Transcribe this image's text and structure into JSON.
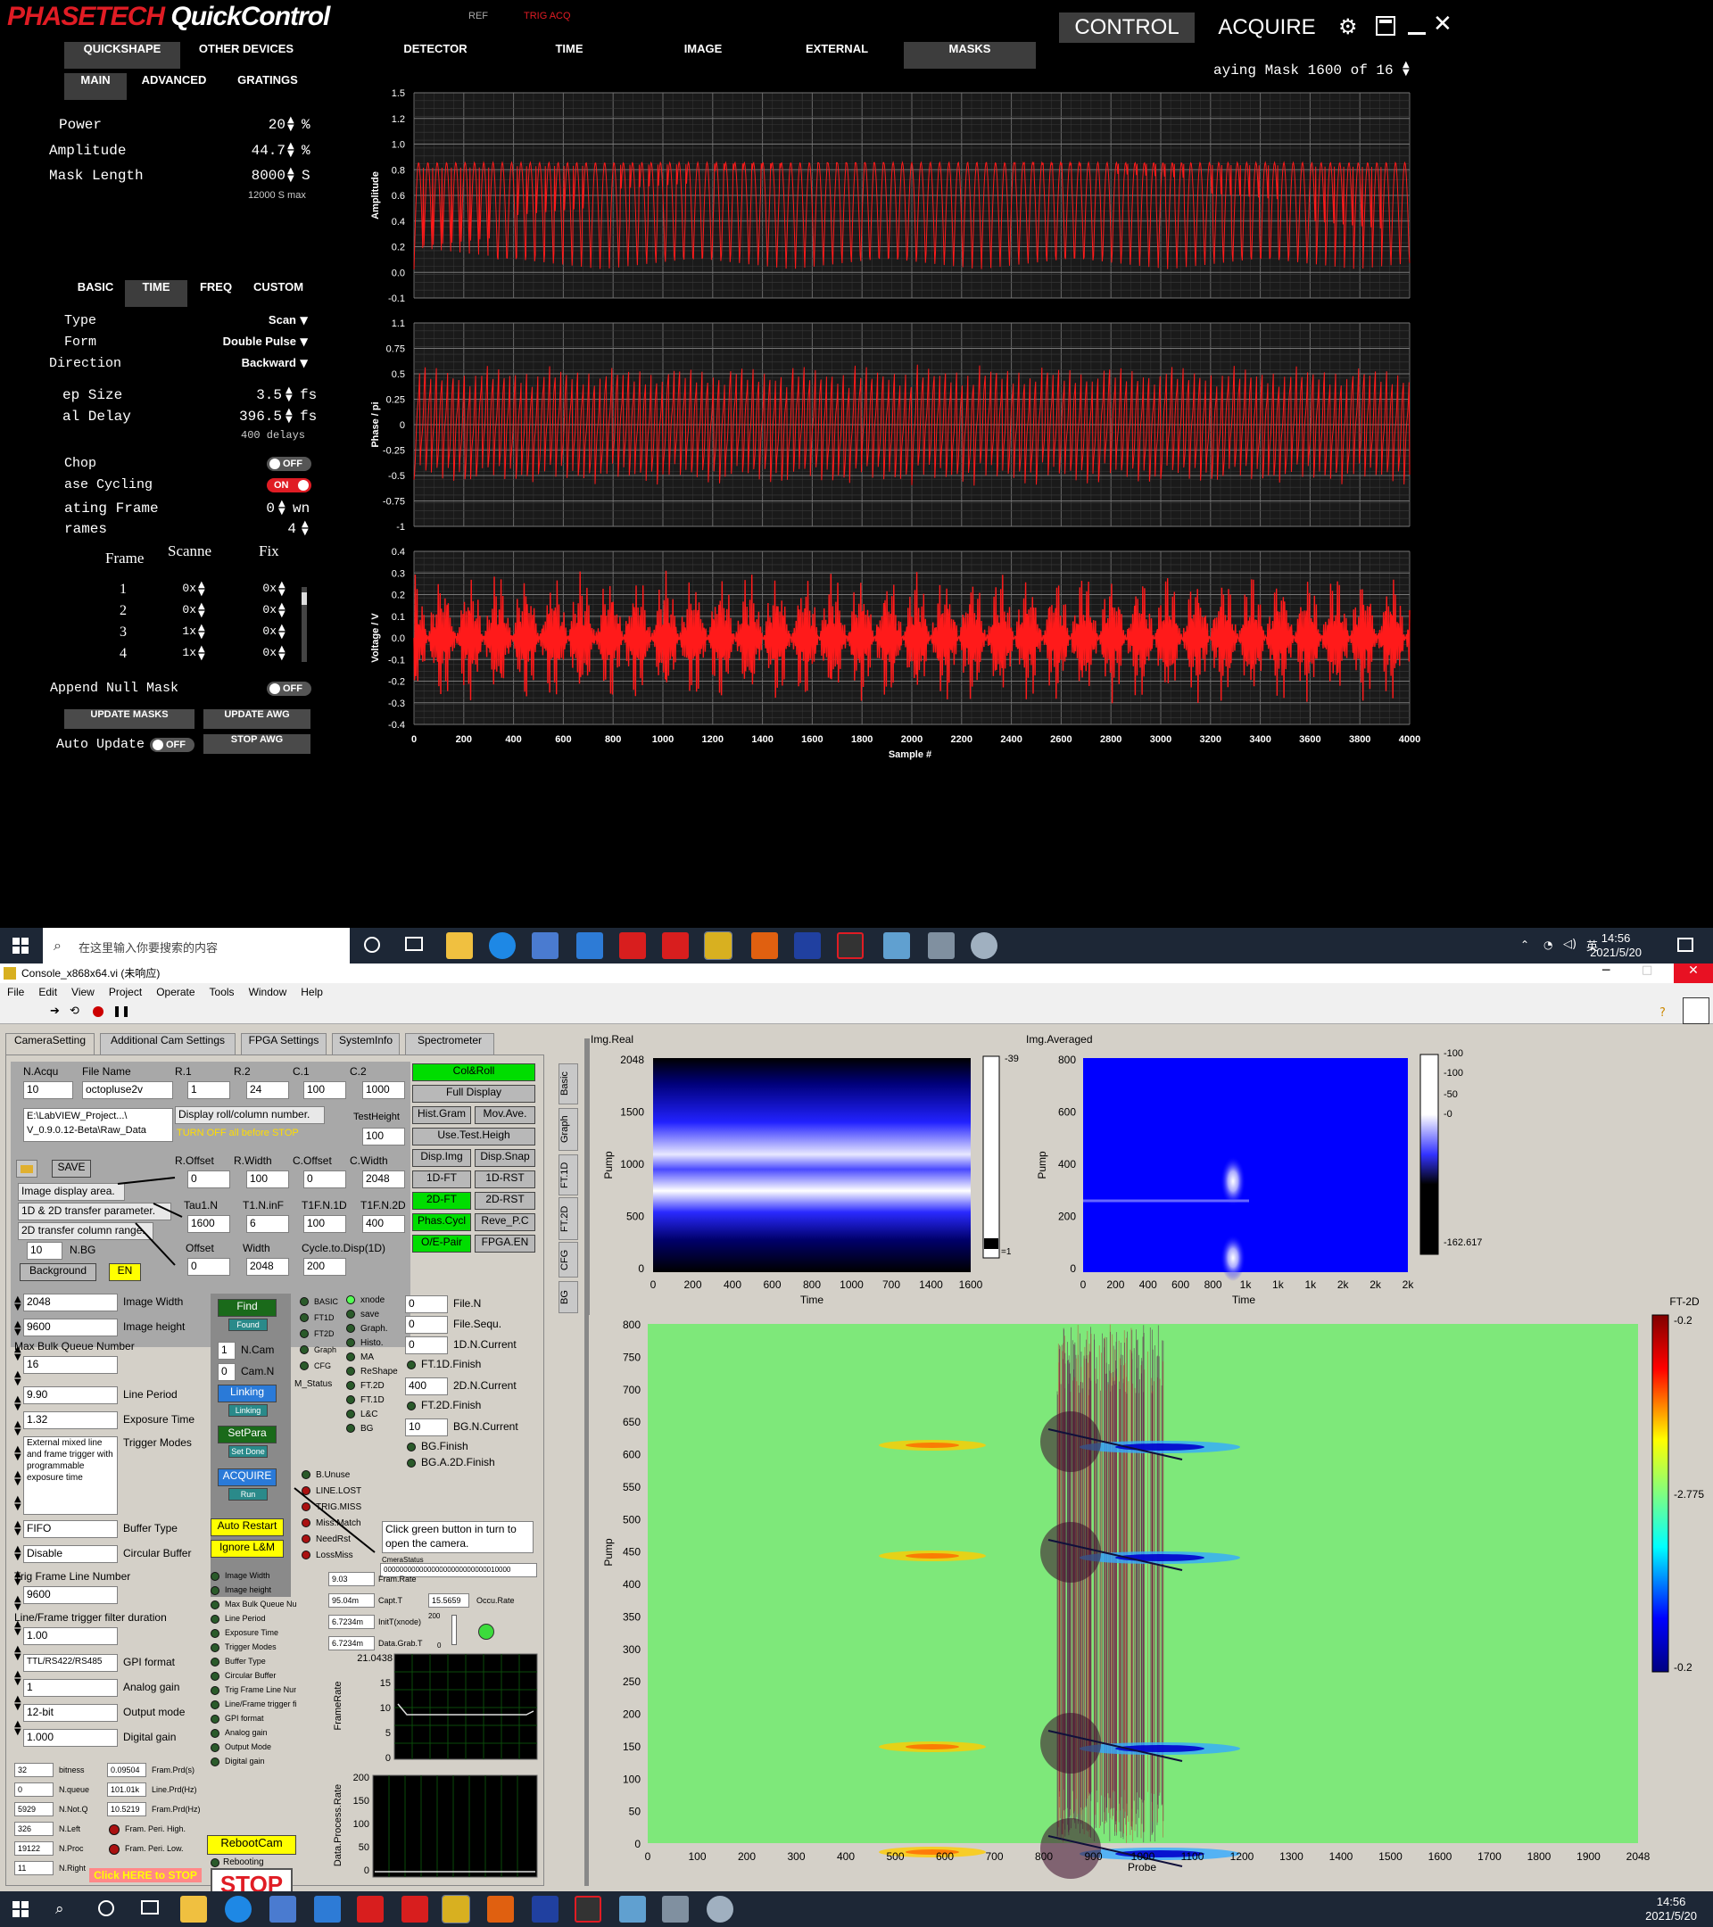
{
  "app": {
    "logo_part1": "PHASETECH",
    "logo_part2": "QuickControl",
    "ref_label": "REF",
    "trig_label": "TRIG ACQ",
    "control_label": "CONTROL",
    "acquire_label": "ACQUIRE",
    "brand_red": "#e01c24"
  },
  "tabs_left": [
    "QUICKSHAPE",
    "OTHER DEVICES"
  ],
  "subtabs_left": [
    "MAIN",
    "ADVANCED",
    "GRATINGS"
  ],
  "tabs_right": [
    "DETECTOR",
    "TIME",
    "IMAGE",
    "EXTERNAL",
    "MASKS"
  ],
  "mask_status": "aying Mask 1600 of 16",
  "main": {
    "power_label": "Power",
    "power_value": "20",
    "power_unit": "%",
    "amplitude_label": "Amplitude",
    "amplitude_value": "44.7",
    "amplitude_unit": "%",
    "mask_length_label": "Mask Length",
    "mask_length_value": "8000",
    "mask_length_unit": "S",
    "mask_max": "12000 S max"
  },
  "subtabs2": [
    "BASIC",
    "TIME",
    "FREQ",
    "CUSTOM"
  ],
  "time": {
    "type_label": "Type",
    "type_value": "Scan",
    "form_label": "Form",
    "form_value": "Double Pulse",
    "direction_label": "Direction",
    "direction_value": "Backward",
    "step_label": "ep Size",
    "step_value": "3.5",
    "step_unit": "fs",
    "delay_label": "al Delay",
    "delay_value": "396.5",
    "delay_unit": "fs",
    "delays_note": "400 delays",
    "chop_label": "Chop",
    "chop_state": "OFF",
    "phase_label": "ase Cycling",
    "phase_state": "ON",
    "rotating_label": "ating  Frame",
    "rotating_value": "0",
    "rotating_unit": "wn",
    "frames_label": "rames",
    "frames_value": "4",
    "frame_col": "Frame",
    "scanned_col": "Scanne",
    "fixed_col": "Fix",
    "rows": [
      {
        "n": "1",
        "s": "0x",
        "f": "0x"
      },
      {
        "n": "2",
        "s": "0x",
        "f": "0x"
      },
      {
        "n": "3",
        "s": "1x",
        "f": "0x"
      },
      {
        "n": "4",
        "s": "1x",
        "f": "0x"
      }
    ],
    "append_label": "Append Null Mask",
    "append_state": "OFF",
    "update_masks": "UPDATE MASKS",
    "update_awg": "UPDATE AWG",
    "auto_update_label": "Auto Update",
    "auto_update_state": "OFF",
    "stop_awg": "STOP AWG"
  },
  "plots": {
    "amp_ylabel": "Amplitude",
    "amp_yticks": [
      "1.5",
      "1.2",
      "1.0",
      "0.8",
      "0.6",
      "0.4",
      "0.2",
      "0.0",
      "-0.1"
    ],
    "phase_ylabel": "Phase / pi",
    "phase_yticks": [
      "1.1",
      "0.75",
      "0.5",
      "0.25",
      "0",
      "-0.25",
      "-0.5",
      "-0.75",
      "-1"
    ],
    "volt_ylabel": "Voltage / V",
    "volt_yticks": [
      "0.4",
      "0.3",
      "0.2",
      "0.1",
      "0.0",
      "-0.1",
      "-0.2",
      "-0.3",
      "-0.4"
    ],
    "xticks": [
      "0",
      "200",
      "400",
      "600",
      "800",
      "1000",
      "1200",
      "1400",
      "1600",
      "1800",
      "2000",
      "2200",
      "2400",
      "2600",
      "2800",
      "3000",
      "3200",
      "3400",
      "3600",
      "3800",
      "4000"
    ],
    "xlabel": "Sample #",
    "trace_color": "#ff1a1a"
  },
  "taskbar": {
    "search_placeholder": "在这里输入你要搜索的内容",
    "time": "14:56",
    "date": "2021/5/20",
    "lang": "英"
  },
  "lv": {
    "title": "Console_x868x64.vi (未响应)",
    "menu": [
      "File",
      "Edit",
      "View",
      "Project",
      "Operate",
      "Tools",
      "Window",
      "Help"
    ],
    "tabs": [
      "CameraSetting",
      "Additional Cam Settings",
      "FPGA Settings",
      "SystemInfo",
      "Spectrometer"
    ],
    "vtabs": [
      "Basic",
      "Graph",
      "FT.1D",
      "FT.2D",
      "CFG",
      "BG"
    ],
    "nacqu_label": "N.Acqu",
    "nacqu_value": "10",
    "filename_label": "File Name",
    "filename_value": "octopluse2v",
    "path_value": "E:\\LabVIEW_Project...\\ V_0.9.0.12-Beta\\Raw_Data",
    "r1_label": "R.1",
    "r1": "1",
    "r2_label": "R.2",
    "r2": "24",
    "c1_label": "C.1",
    "c1": "100",
    "c2_label": "C.2",
    "c2": "1000",
    "display_note": "Display roll/column number.",
    "turn_off_note": "TURN OFF all before STOP",
    "testheight_label": "TestHeight",
    "testheight": "100",
    "save_label": "SAVE",
    "roffset_label": "R.Offset",
    "roffset": "0",
    "rwidth_label": "R.Width",
    "rwidth": "100",
    "coffset_label": "C.Offset",
    "coffset": "0",
    "cwidth_label": "C.Width",
    "cwidth": "2048",
    "image_area_note": "Image display area.",
    "transfer_note": "1D & 2D transfer parameter.",
    "col_range_note": "2D transfer column range.",
    "tau1_label": "Tau1.N",
    "tau1": "1600",
    "t1finf_label": "T1.N.inF",
    "t1finf": "6",
    "t1fn1d_label": "T1F.N.1D",
    "t1fn1d": "100",
    "t1fn2d_label": "T1F.N.2D",
    "t1fn2d": "400",
    "offset_label": "Offset",
    "offset": "0",
    "width_label": "Width",
    "width": "2048",
    "cycle_label": "Cycle.to.Disp(1D)",
    "cycle": "200",
    "nbg_label": "N.BG",
    "nbg": "10",
    "background_label": "Background",
    "en_label": "EN",
    "right_btns": [
      [
        "Col&Roll",
        ""
      ],
      [
        "Full Display",
        ""
      ],
      [
        "Hist.Gram",
        "Mov.Ave."
      ],
      [
        "Use.Test.Heigh",
        ""
      ],
      [
        "Disp.Img",
        "Disp.Snap"
      ],
      [
        "1D-FT",
        "1D-RST"
      ],
      [
        "2D-FT",
        "2D-RST"
      ],
      [
        "Phas.Cycl",
        "Reve_P.C"
      ],
      [
        "O/E-Pair",
        "FPGA.EN"
      ]
    ],
    "image_width_label": "Image Width",
    "image_width": "2048",
    "image_height_label": "Image height",
    "image_height": "9600",
    "max_bulk_label": "Max Bulk Queue Number",
    "max_bulk": "16",
    "line_period_label": "Line Period",
    "line_period": "9.90",
    "exposure_label": "Exposure Time",
    "exposure": "1.32",
    "trigger_modes_label": "Trigger Modes",
    "trigger_modes_value": "External mixed line and frame trigger with programmable exposure time",
    "buffer_type_label": "Buffer Type",
    "buffer_type": "FIFO",
    "circular_label": "Circular Buffer",
    "circular": "Disable",
    "trig_frame_label": "Trig Frame Line Number",
    "trig_frame": "9600",
    "filter_label": "Line/Frame trigger filter duration",
    "filter": "1.00",
    "gpi_label": "GPI format",
    "gpi": "TTL/RS422/RS485",
    "analog_label": "Analog gain",
    "analog": "1",
    "output_label": "Output mode",
    "output": "12-bit",
    "digital_label": "Digital gain",
    "digital": "1.000",
    "find": "Find",
    "found": "Found",
    "ncam_label": "N.Cam",
    "ncam": "1",
    "camn_label": "Cam.N",
    "camn": "0",
    "linking": "Linking",
    "linking2": "Linking",
    "setpara": "SetPara",
    "setdone": "Set Done",
    "acquire": "ACQUIRE",
    "run": "Run",
    "status_leds": [
      "BASIC",
      "FT1D",
      "FT2D",
      "Graph",
      "CFG"
    ],
    "mstatus_label": "M_Status",
    "right_leds": [
      "xnode",
      "save",
      "Graph.",
      "Histo.",
      "MA",
      "ReShape",
      "FT.2D",
      "FT.1D",
      "L&C",
      "BG"
    ],
    "filen_label": "File.N",
    "filen": "0",
    "filesequ_label": "File.Sequ.",
    "filesequ": "0",
    "n1d_label": "1D.N.Current",
    "n1d": "0",
    "ft1d_finish": "FT.1D.Finish",
    "n2d_label": "2D.N.Current",
    "n2d": "400",
    "ft2d_finish": "FT.2D.Finish",
    "bgn_label": "BG.N.Current",
    "bgn": "10",
    "bg_finish": "BG.Finish",
    "bga_finish": "BG.A.2D.Finish",
    "err_leds": [
      "B.Unuse",
      "LINE.LOST",
      "TRIG.MISS",
      "Miss.Match",
      "NeedRst",
      "LossMiss"
    ],
    "click_note": "Click green button in turn to open the camera.",
    "camstatus_label": "CmeraStatus",
    "camstatus": "00000000000000000000000000010000",
    "auto_restart": "Auto Restart",
    "ignore_lm": "Ignore L&M",
    "param_leds": [
      "Image Width",
      "Image height",
      "Max Bulk Queue Number",
      "Line Period",
      "Exposure Time",
      "Trigger Modes",
      "Buffer Type",
      "Circular Buffer",
      "Trig Frame Line Number",
      "Line/Frame trigger filter duration",
      "GPI format",
      "Analog gain",
      "Output Mode",
      "Digital gain"
    ],
    "framrate_label": "Fram.Rate",
    "framrate": "9.03",
    "captt_label": "Capt.T",
    "captt": "95.04m",
    "occurate_label": "Occu.Rate",
    "occurate": "15.5659",
    "initt_label": "InitT(xnode)",
    "initt": "6.7234m",
    "datagrab_label": "Data.Grab.T",
    "datagrab": "6.7234m",
    "slider_top": "200",
    "slider_bot": "0",
    "framerate_chart_label": "FrameRate",
    "framerate_max": "21.0438",
    "fr_ticks": [
      "15",
      "10",
      "5",
      "0"
    ],
    "dp_chart_label": "Data.Process.Rate",
    "dp_ticks": [
      "200",
      "150",
      "100",
      "50",
      "0"
    ],
    "stats": [
      [
        "32",
        "bitness",
        "0.09504",
        "Fram.Prd(s)"
      ],
      [
        "0",
        "N.queue",
        "101.01k",
        "Line.Prd(Hz)"
      ],
      [
        "5929",
        "N.Not.Q",
        "10.5219",
        "Fram.Prd(Hz)"
      ],
      [
        "326",
        "N.Left",
        "",
        "Fram. Peri. High."
      ],
      [
        "19122",
        "N.Proc",
        "",
        "Fram. Peri. Low."
      ],
      [
        "11",
        "N.Right",
        "",
        ""
      ]
    ],
    "click_stop": "Click HERE to STOP",
    "rebootcam": "RebootCam",
    "rebooting": "Rebooting",
    "stop": "STOP",
    "img_real_label": "Img.Real",
    "img_real_yticks": [
      "2048",
      "1500",
      "1000",
      "500",
      "0"
    ],
    "img_real_xticks": [
      "0",
      "200",
      "400",
      "600",
      "800",
      "1000",
      "700",
      "1400",
      "1600"
    ],
    "img_real_ylabel": "Pump",
    "img_real_xlabel": "Time",
    "img_real_scale": [
      "-39",
      "=1"
    ],
    "img_avg_label": "Img.Averaged",
    "img_avg_yticks": [
      "800",
      "600",
      "400",
      "200",
      "0"
    ],
    "img_avg_xticks": [
      "0",
      "200",
      "400",
      "600",
      "800",
      "1k",
      "1k",
      "1k",
      "2k",
      "2k",
      "2k"
    ],
    "img_avg_ylabel": "Pump",
    "img_avg_xlabel": "Time",
    "img_avg_scale": [
      "-100",
      "-100",
      "-50",
      "-0",
      "-162.617"
    ],
    "ft2d_label": "FT-2D",
    "ft2d_yticks": [
      "800",
      "750",
      "700",
      "650",
      "600",
      "550",
      "500",
      "450",
      "400",
      "350",
      "300",
      "250",
      "200",
      "150",
      "100",
      "50",
      "0"
    ],
    "ft2d_xticks": [
      "0",
      "100",
      "200",
      "300",
      "400",
      "500",
      "600",
      "700",
      "800",
      "900",
      "1000",
      "1100",
      "1200",
      "1300",
      "1400",
      "1500",
      "1600",
      "1700",
      "1800",
      "1900",
      "2048"
    ],
    "ft2d_ylabel": "Pump",
    "ft2d_xlabel": "Probe",
    "ft2d_scale": [
      "-0.2",
      "-2.775",
      "-0.2"
    ]
  }
}
